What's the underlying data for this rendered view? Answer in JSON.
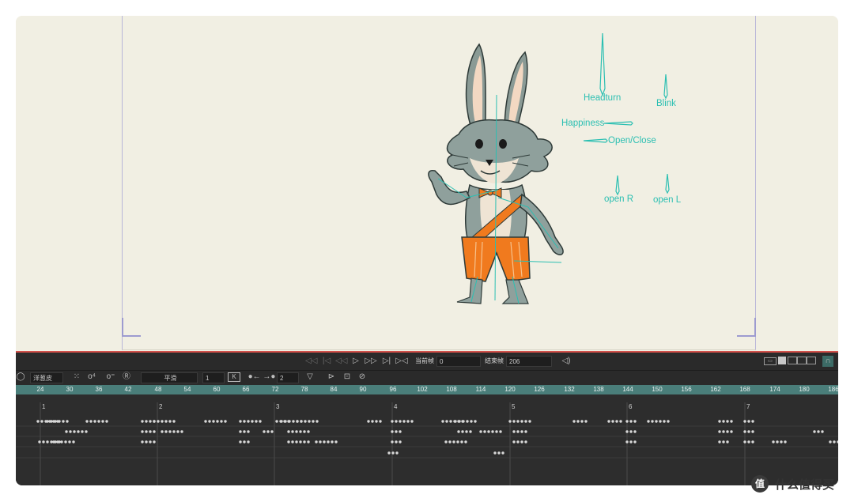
{
  "rig_labels": {
    "headturn": "Headturn",
    "blink": "Blink",
    "happiness": "Happiness",
    "open_close": "Open/Close",
    "open_r": "open R",
    "open_l": "open L"
  },
  "toolbar": {
    "current_frame_label": "当前帧",
    "current_frame_value": "0",
    "end_frame_label": "结束帧",
    "end_frame_value": "206",
    "onion_skin_label": "洋葱皮",
    "easing_label": "平滑",
    "step_value": "1",
    "keyframe_label": "K",
    "frame_step_value": "2"
  },
  "ruler_ticks": [
    "24",
    "30",
    "36",
    "42",
    "48",
    "54",
    "60",
    "66",
    "72",
    "78",
    "84",
    "90",
    "96",
    "102",
    "108",
    "114",
    "120",
    "126",
    "132",
    "138",
    "144",
    "150",
    "156",
    "162",
    "168",
    "174",
    "180",
    "186"
  ],
  "track_markers": [
    "1",
    "2",
    "3",
    "4",
    "5",
    "6",
    "7"
  ],
  "watermark": {
    "badge": "值",
    "text": "什么值得买"
  },
  "colors": {
    "canvas_bg": "#f1efe3",
    "rig_accent": "#2bbfb2",
    "timeline_bg": "#2d2d2d",
    "ruler_bg": "#4a7e7a",
    "playhead_line": "#d2504a"
  }
}
